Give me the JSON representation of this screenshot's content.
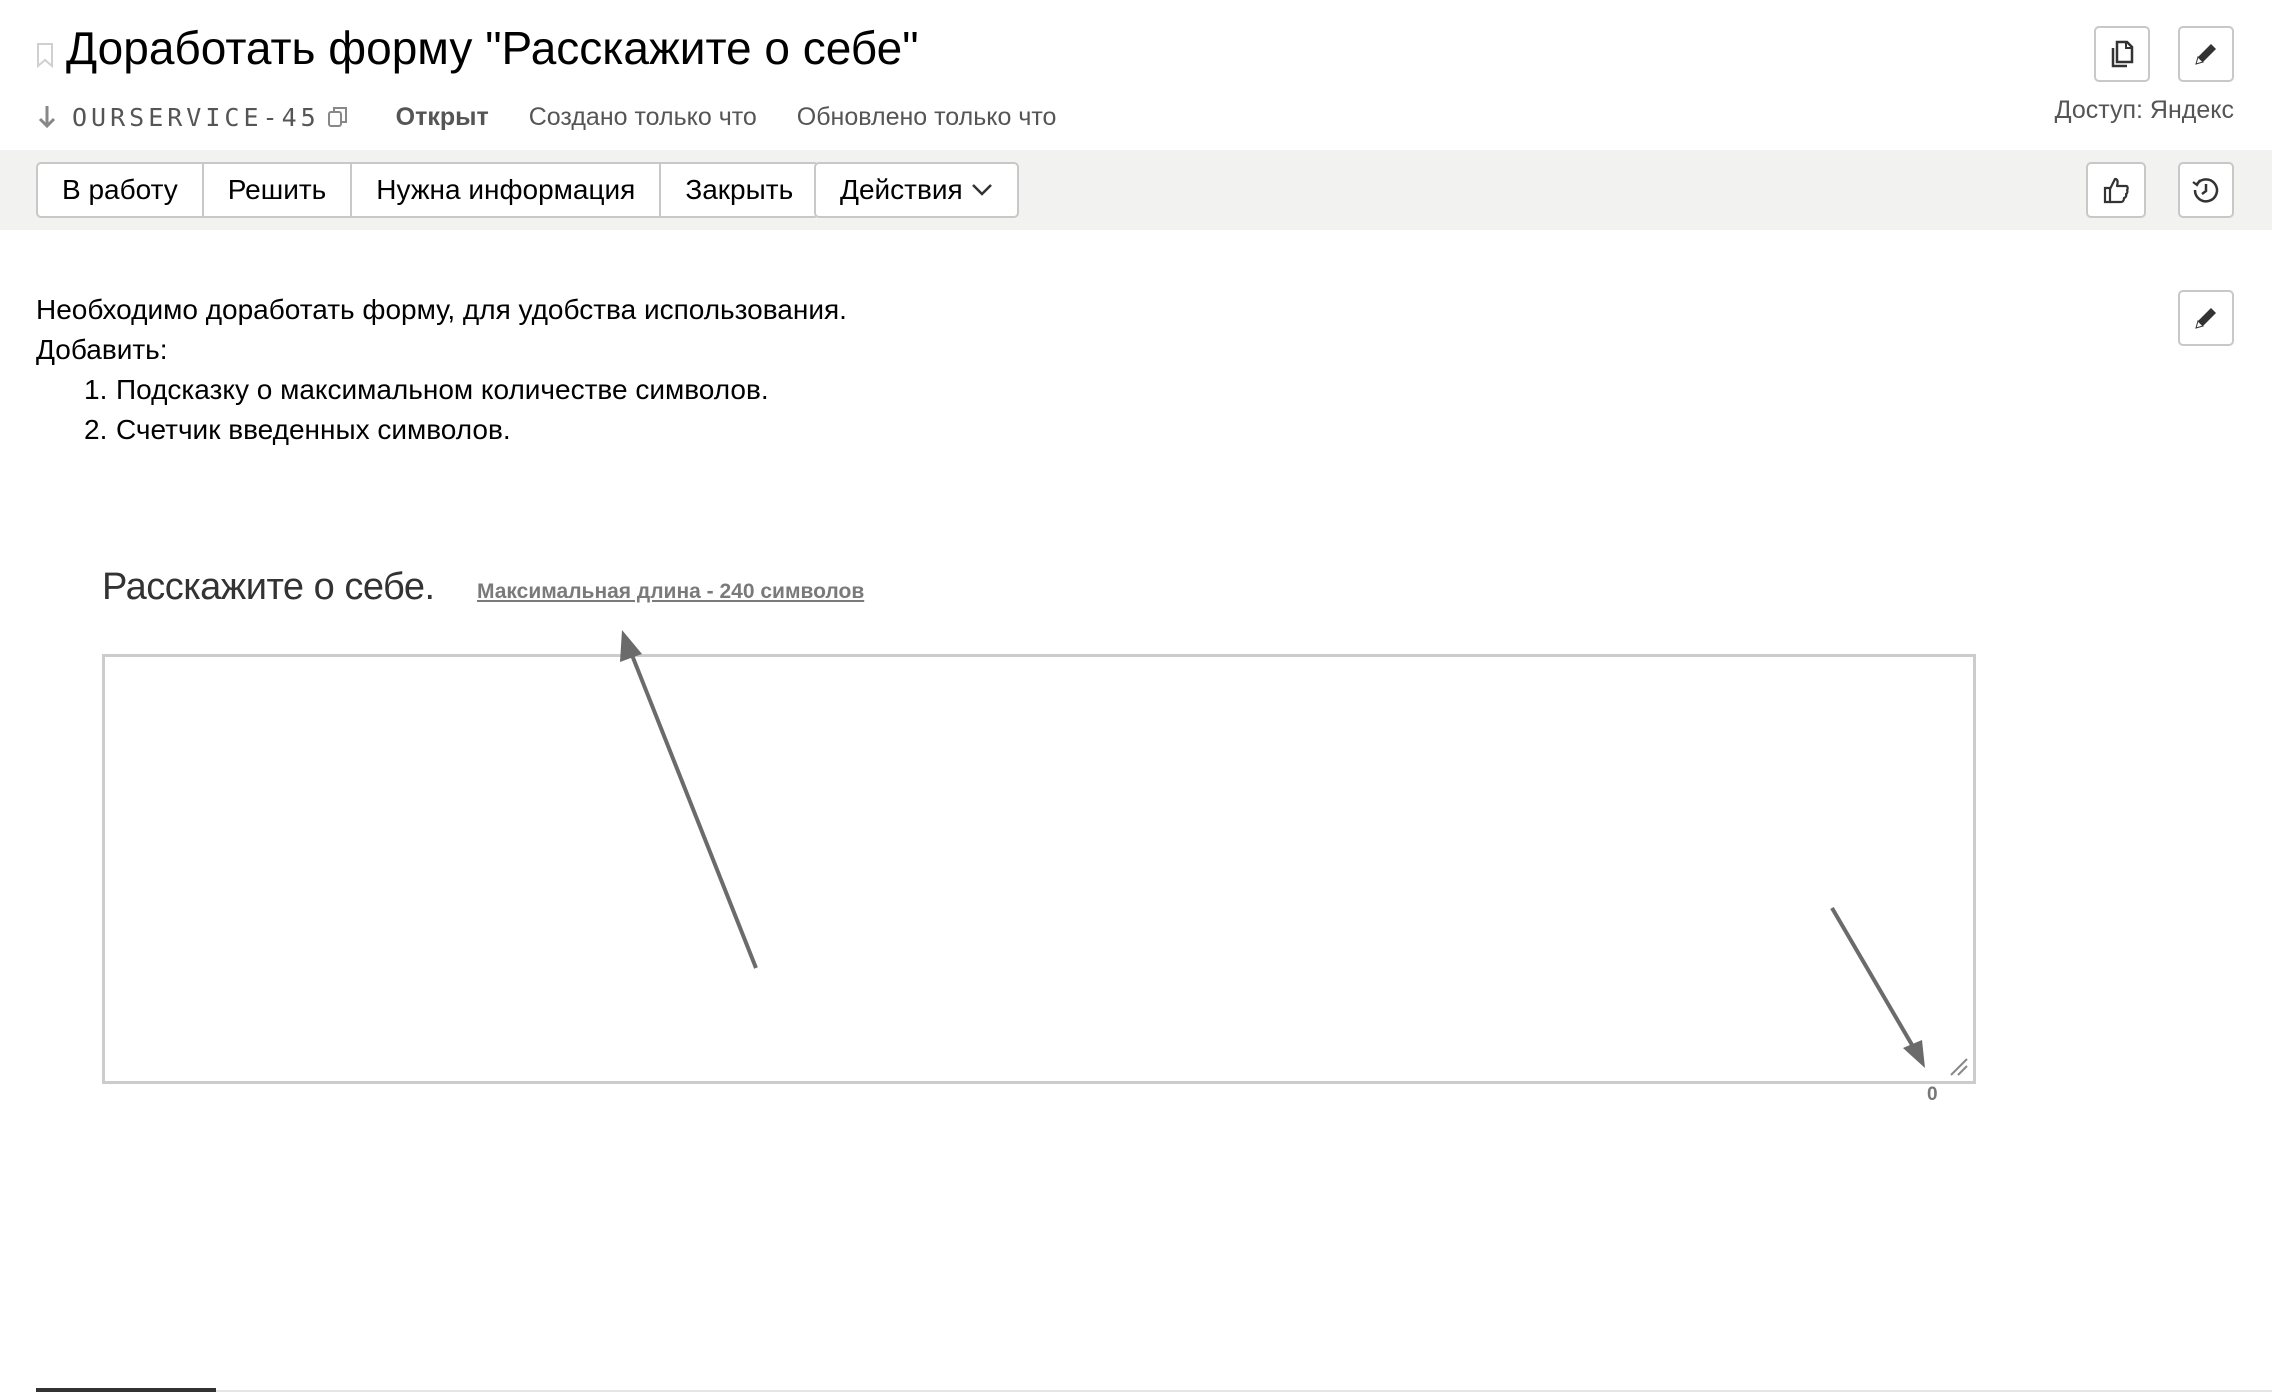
{
  "header": {
    "title": "Доработать форму \"Расскажите о себе\"",
    "issue_key": "OURSERVICE-45",
    "status": "Открыт",
    "created": "Создано только что",
    "updated": "Обновлено только что",
    "access": "Доступ: Яндекс"
  },
  "toolbar": {
    "buttons": [
      "В работу",
      "Решить",
      "Нужна информация",
      "Закрыть"
    ],
    "actions_label": "Действия"
  },
  "description": {
    "line1": "Необходимо доработать форму, для удобства использования.",
    "line2": "Добавить:",
    "items": [
      {
        "num": "1.",
        "text": "Подсказку о максимальном количестве символов."
      },
      {
        "num": "2.",
        "text": "Счетчик введенных символов."
      }
    ]
  },
  "attachment": {
    "form_title": "Расскажите о себе.",
    "hint": "Максимальная длина - 240 символов",
    "counter": "0"
  },
  "icons": {
    "bookmark": "bookmark-icon",
    "down_arrow": "down-arrow-icon",
    "copy_key": "copy-icon",
    "clone": "clone-icon",
    "edit": "pencil-icon",
    "like": "thumbs-up-icon",
    "history": "history-icon",
    "chevron": "chevron-down-icon"
  },
  "colors": {
    "toolbar_bg": "#f2f2f1",
    "border": "#c8c8c8",
    "muted_text": "#555555",
    "annotation_arrow": "#6b6b6b"
  }
}
